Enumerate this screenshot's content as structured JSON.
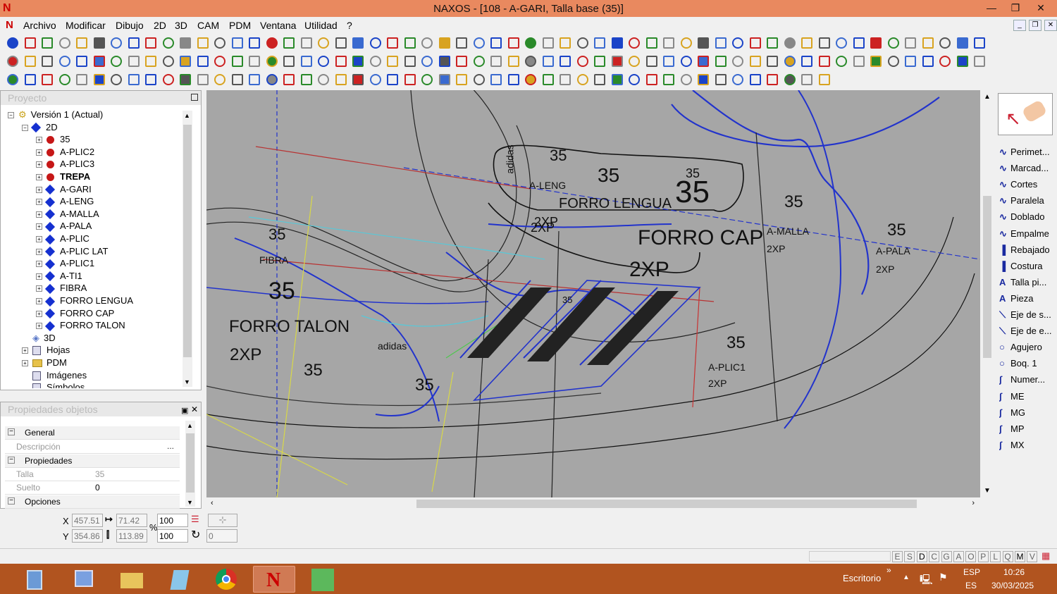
{
  "window": {
    "title": "NAXOS - [108 - A-GARI, Talla base (35)]",
    "minimize": "—",
    "restore": "❐",
    "close": "✕"
  },
  "menu": [
    "Archivo",
    "Modificar",
    "Dibujo",
    "2D",
    "3D",
    "CAM",
    "PDM",
    "Ventana",
    "Utilidad",
    "?"
  ],
  "project": {
    "header": "Proyecto",
    "tree": [
      {
        "label": "Versión 1 (Actual)",
        "icon": "version",
        "depth": 0
      },
      {
        "label": "2D",
        "icon": "diamond",
        "depth": 1
      },
      {
        "label": "35",
        "icon": "red",
        "depth": 2
      },
      {
        "label": "A-PLIC2",
        "icon": "red",
        "depth": 2
      },
      {
        "label": "A-PLIC3",
        "icon": "red",
        "depth": 2
      },
      {
        "label": "TREPA",
        "icon": "red",
        "depth": 2,
        "bold": true
      },
      {
        "label": "A-GARI",
        "icon": "diamond",
        "depth": 2
      },
      {
        "label": "A-LENG",
        "icon": "diamond",
        "depth": 2
      },
      {
        "label": "A-MALLA",
        "icon": "diamond",
        "depth": 2
      },
      {
        "label": "A-PALA",
        "icon": "diamond",
        "depth": 2
      },
      {
        "label": "A-PLIC",
        "icon": "diamond",
        "depth": 2
      },
      {
        "label": "A-PLIC LAT",
        "icon": "diamond",
        "depth": 2
      },
      {
        "label": "A-PLIC1",
        "icon": "diamond",
        "depth": 2
      },
      {
        "label": "A-TI1",
        "icon": "diamond",
        "depth": 2
      },
      {
        "label": "FIBRA",
        "icon": "diamond",
        "depth": 2
      },
      {
        "label": "FORRO  LENGUA",
        "icon": "diamond",
        "depth": 2
      },
      {
        "label": "FORRO CAP",
        "icon": "diamond",
        "depth": 2
      },
      {
        "label": "FORRO TALON",
        "icon": "diamond",
        "depth": 2
      },
      {
        "label": "3D",
        "icon": "3d",
        "depth": 1
      },
      {
        "label": "Hojas",
        "icon": "doc",
        "depth": 1
      },
      {
        "label": "PDM",
        "icon": "folder",
        "depth": 1
      },
      {
        "label": "Imágenes",
        "icon": "doc",
        "depth": 1
      },
      {
        "label": "Símbolos",
        "icon": "doc",
        "depth": 1
      }
    ]
  },
  "properties": {
    "header": "Propiedades objetos",
    "sections": {
      "general": "General",
      "props": "Propiedades",
      "options": "Opciones"
    },
    "descripcion_label": "Descripción",
    "descripcion_value": "",
    "ellipsis": "...",
    "talla_label": "Talla",
    "talla_value": "35",
    "suelto_label": "Suelto",
    "suelto_value": "0"
  },
  "coords": {
    "x_label": "X",
    "x": "457.51",
    "y_label": "Y",
    "y": "354.86",
    "w": "71.42",
    "h": "113.89",
    "sx": "100",
    "sy": "100",
    "pct": "%",
    "angle": "0"
  },
  "canvas_labels": [
    "35",
    "35",
    "35",
    "35",
    "35",
    "35",
    "35",
    "35",
    "35",
    "35",
    "35",
    "35",
    "FORRO  LENGUA",
    "FORRO CAP",
    "FORRO TALON",
    "2XP",
    "2XP",
    "2XP",
    "2XP",
    "2XP",
    "2XP",
    "2XP",
    "A-LENG",
    "A-MALLA",
    "A-PALA",
    "A-PLIC1",
    "FIBRA",
    "adidas",
    "adidas"
  ],
  "right_panel": [
    "Perimet...",
    "Marcad...",
    "Cortes",
    "Paralela",
    "Doblado",
    "Empalme",
    "Rebajado",
    "Costura",
    "Talla pi...",
    "Pieza",
    "Eje de s...",
    "Eje de e...",
    "Agujero",
    "Boq. 1",
    "Numer...",
    "ME",
    "MG",
    "MP",
    "MX"
  ],
  "status_letters": [
    "E",
    "S",
    "D",
    "C",
    "G",
    "A",
    "O",
    "P",
    "L",
    "Q",
    "M",
    "V"
  ],
  "taskbar": {
    "desktop": "Escritorio",
    "chevron": "»",
    "lang1": "ESP",
    "lang2": "ES",
    "time": "10:26",
    "date": "30/03/2025"
  }
}
